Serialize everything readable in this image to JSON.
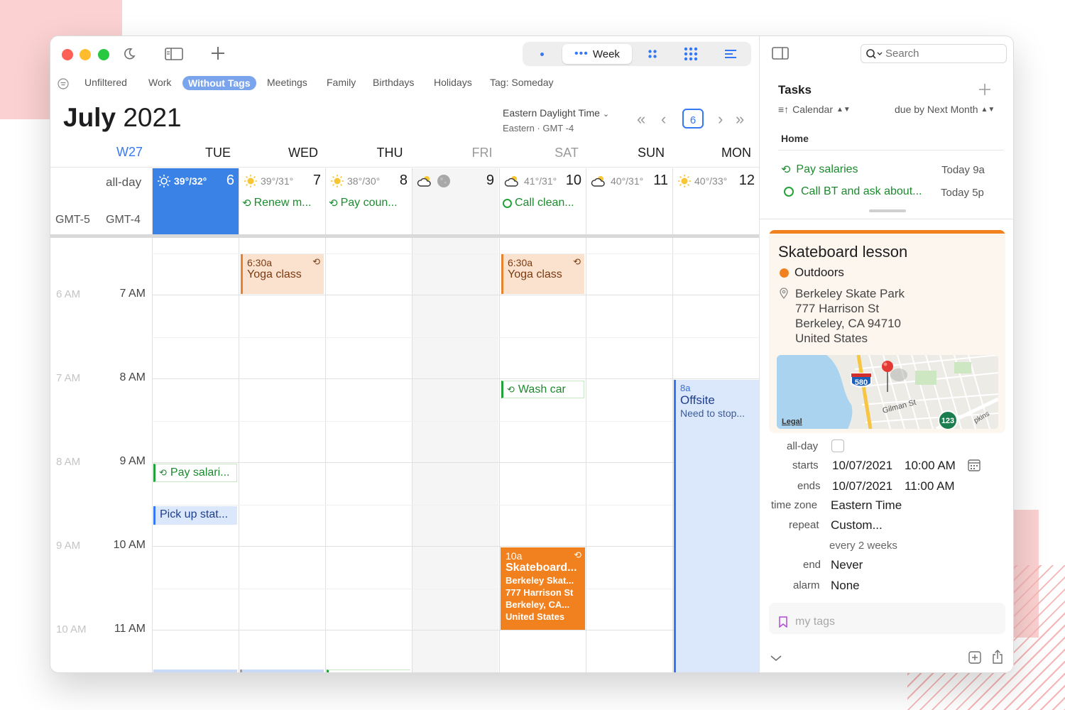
{
  "toolbar": {
    "view_week": "Week",
    "accent": "#3478f6"
  },
  "filters": [
    "Unfiltered",
    "Work",
    "Without Tags",
    "Meetings",
    "Family",
    "Birthdays",
    "Holidays",
    "Tag: Someday"
  ],
  "header": {
    "month": "July",
    "year": "2021",
    "timezone": "Eastern Daylight Time",
    "timezone_sub": "Eastern · GMT -4",
    "today_badge": "6",
    "week": "W27"
  },
  "days": [
    {
      "name": "TUE",
      "num": "6",
      "weather": "39°/32°",
      "icon": "sun-outline-icon",
      "allday": ""
    },
    {
      "name": "WED",
      "num": "7",
      "weather": "39°/31°",
      "icon": "sun-icon",
      "allday": "Renew m..."
    },
    {
      "name": "THU",
      "num": "8",
      "weather": "38°/30°",
      "icon": "sun-icon",
      "allday": "Pay coun..."
    },
    {
      "name": "FRI",
      "num": "9",
      "weather": "",
      "icon": "partly-cloudy-icon",
      "allday": ""
    },
    {
      "name": "SAT",
      "num": "10",
      "weather": "41°/31°",
      "icon": "partly-cloudy-icon",
      "allday": "Call clean..."
    },
    {
      "name": "SUN",
      "num": "11",
      "weather": "40°/31°",
      "icon": "partly-cloudy-icon",
      "allday": ""
    },
    {
      "name": "MON",
      "num": "12",
      "weather": "40°/33°",
      "icon": "sun-icon",
      "allday": ""
    }
  ],
  "allday_label": "all-day",
  "gmt_labels": [
    "GMT-5",
    "GMT-4"
  ],
  "hours": [
    {
      "main": "7 AM",
      "secondary": "6 AM"
    },
    {
      "main": "8 AM",
      "secondary": "7 AM"
    },
    {
      "main": "9 AM",
      "secondary": "8 AM"
    },
    {
      "main": "10 AM",
      "secondary": "9 AM"
    },
    {
      "main": "11 AM",
      "secondary": "10 AM"
    }
  ],
  "events": {
    "yoga_wed": {
      "time": "6:30a",
      "title": "Yoga class"
    },
    "yoga_sat": {
      "time": "6:30a",
      "title": "Yoga class"
    },
    "wash_car": {
      "title": "Wash car"
    },
    "pay_salaries": {
      "title": "Pay salari..."
    },
    "pick_up": {
      "title": "Pick up stat..."
    },
    "offsite": {
      "time": "8a",
      "title": "Offsite",
      "note": "Need to stop..."
    },
    "skateboard": {
      "time": "10a",
      "title": "Skateboard...",
      "lines": [
        "Berkeley Skat...",
        "777 Harrison St",
        "Berkeley, CA...",
        "United States"
      ]
    }
  },
  "sidebar": {
    "search_placeholder": "Search",
    "tasks_title": "Tasks",
    "sort_label": "Calendar",
    "due_label": "due by Next Month",
    "group": "Home",
    "tasks": [
      {
        "title": "Pay salaries",
        "due": "Today 9a"
      },
      {
        "title": "Call BT and ask about...",
        "due": "Today 5p"
      }
    ]
  },
  "detail": {
    "title": "Skateboard lesson",
    "calendar": "Outdoors",
    "calendar_color": "#f0811e",
    "location": [
      "Berkeley Skate Park",
      "777 Harrison St",
      "Berkeley, CA  94710",
      "United States"
    ],
    "map_legal": "Legal",
    "map_highway": "580",
    "map_route": "123",
    "map_street": "Gilman St",
    "map_street2": "pkins",
    "allday_label": "all-day",
    "starts_label": "starts",
    "starts_date": "10/07/2021",
    "starts_time": "10:00 AM",
    "ends_label": "ends",
    "ends_date": "10/07/2021",
    "ends_time": "11:00 AM",
    "tz_label": "time zone",
    "tz_value": "Eastern Time",
    "repeat_label": "repeat",
    "repeat_value": "Custom...",
    "repeat_sub": "every 2 weeks",
    "end_label": "end",
    "end_value": "Never",
    "alarm_label": "alarm",
    "alarm_value": "None",
    "tags_placeholder": "my tags"
  }
}
